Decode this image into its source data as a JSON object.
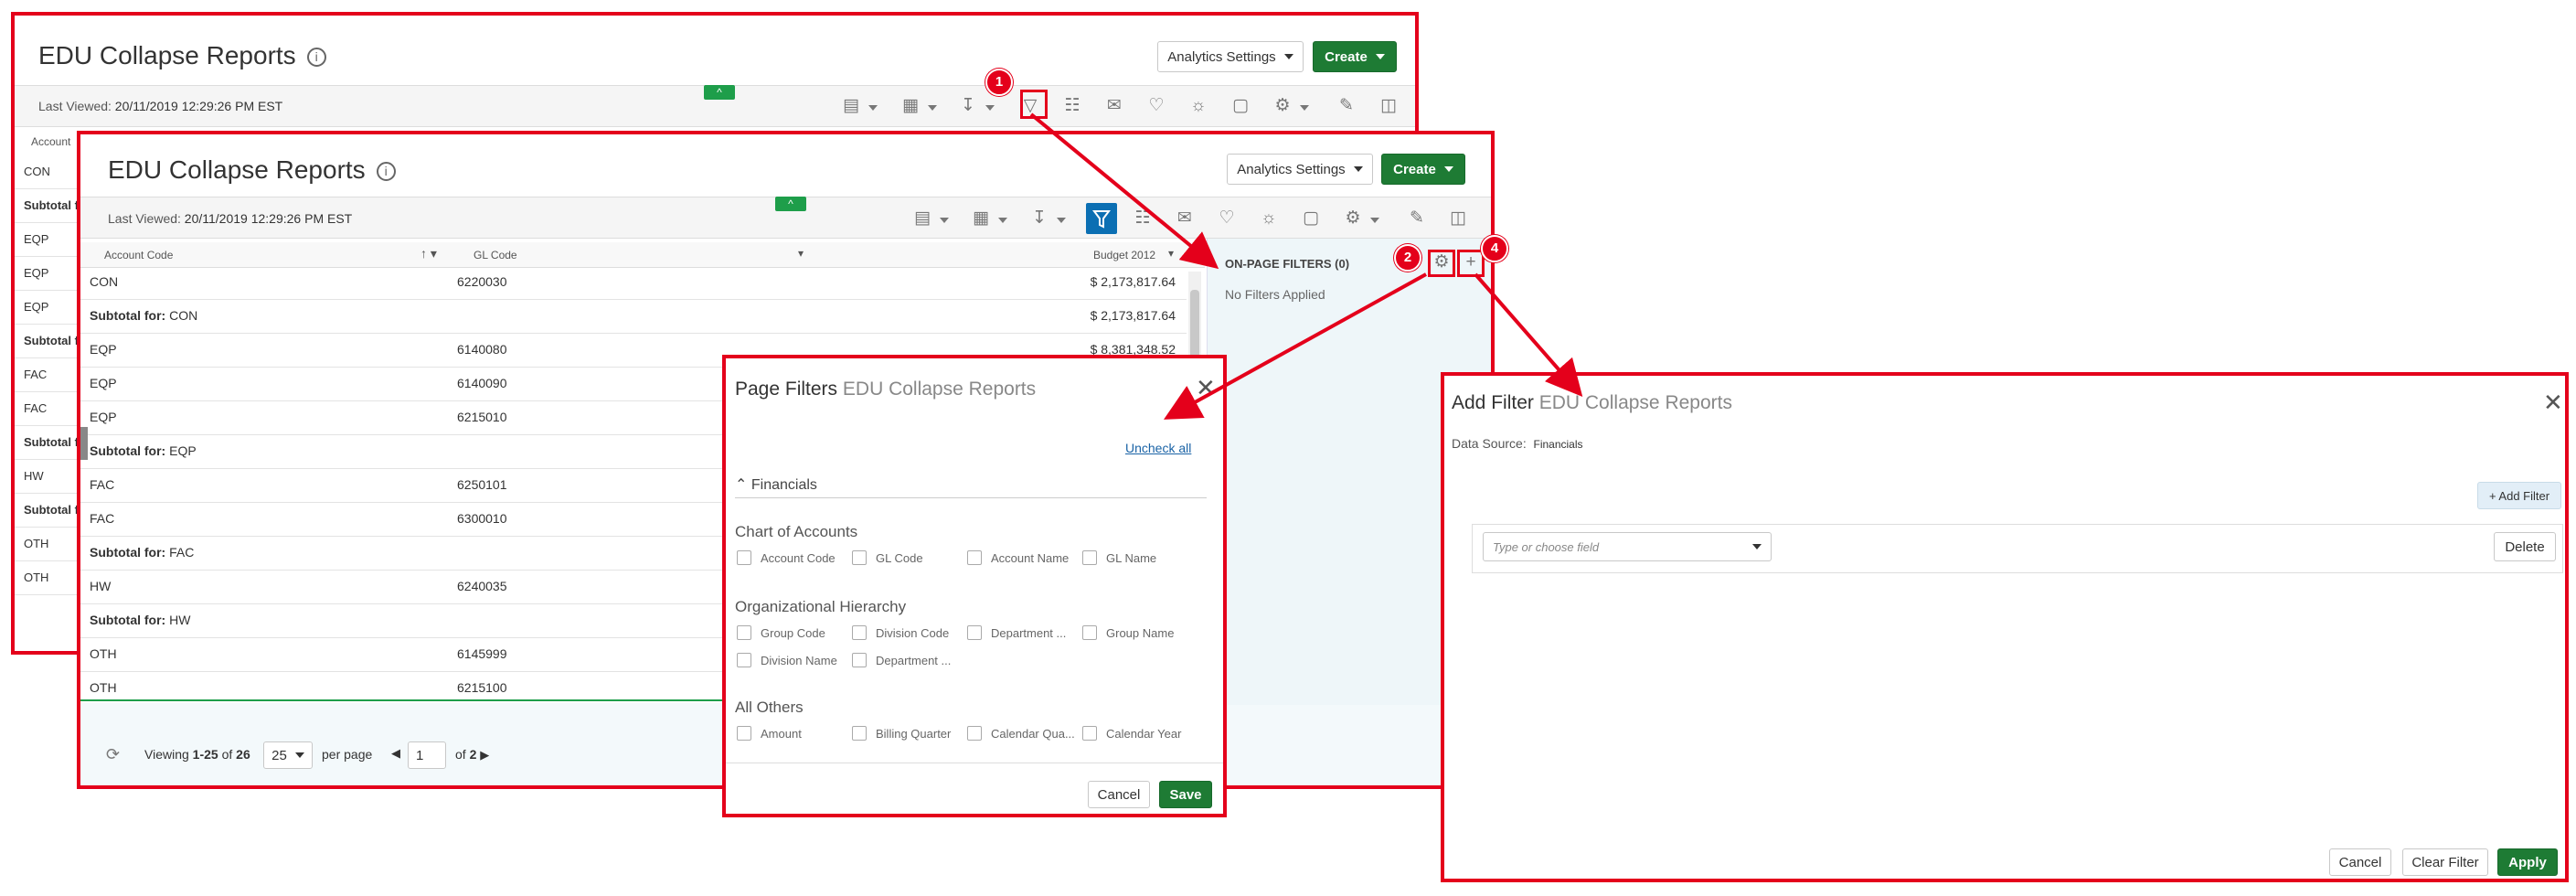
{
  "report": {
    "title": "EDU Collapse Reports",
    "analytics_label": "Analytics Settings",
    "create_label": "Create",
    "last_viewed_label": "Last Viewed:",
    "last_viewed_value": "20/11/2019 12:29:26 PM EST"
  },
  "back_rows": [
    "CON",
    "Subtotal f",
    "EQP",
    "EQP",
    "EQP",
    "Subtotal f",
    "FAC",
    "FAC",
    "Subtotal f",
    "HW",
    "Subtotal f",
    "OTH",
    "OTH"
  ],
  "back_header": "Account",
  "table": {
    "headers": {
      "account": "Account Code",
      "gl": "GL Code",
      "budget": "Budget 2012"
    },
    "rows": [
      {
        "account": "CON",
        "gl": "6220030",
        "budget": "$ 2,173,817.64"
      },
      {
        "subtotal_prefix": "Subtotal for:",
        "subtotal_of": "CON",
        "budget": "$ 2,173,817.64"
      },
      {
        "account": "EQP",
        "gl": "6140080",
        "budget": "$ 8,381,348.52"
      },
      {
        "account": "EQP",
        "gl": "6140090",
        "budget": ""
      },
      {
        "account": "EQP",
        "gl": "6215010",
        "budget": ""
      },
      {
        "subtotal_prefix": "Subtotal for:",
        "subtotal_of": "EQP",
        "budget": ""
      },
      {
        "account": "FAC",
        "gl": "6250101",
        "budget": ""
      },
      {
        "account": "FAC",
        "gl": "6300010",
        "budget": ""
      },
      {
        "subtotal_prefix": "Subtotal for:",
        "subtotal_of": "FAC",
        "budget": ""
      },
      {
        "account": "HW",
        "gl": "6240035",
        "budget": ""
      },
      {
        "subtotal_prefix": "Subtotal for:",
        "subtotal_of": "HW",
        "budget": ""
      },
      {
        "account": "OTH",
        "gl": "6145999",
        "budget": ""
      },
      {
        "account": "OTH",
        "gl": "6215100",
        "budget": ""
      }
    ]
  },
  "pagination": {
    "viewing": "Viewing",
    "range": "1-25",
    "of": "of",
    "total": "26",
    "per_page_value": "25",
    "per_page_label": "per page",
    "page_value": "1",
    "of_pages": "of",
    "pages": "2"
  },
  "onpage": {
    "title": "ON-PAGE FILTERS (0)",
    "empty": "No Filters Applied"
  },
  "page_filters": {
    "title_prefix": "Page Filters",
    "title_suffix": "EDU Collapse Reports",
    "uncheck_all": "Uncheck all",
    "section": "Financials",
    "groups": [
      {
        "label": "Chart of Accounts",
        "items": [
          "Account Code",
          "GL Code",
          "Account Name",
          "GL Name"
        ]
      },
      {
        "label": "Organizational Hierarchy",
        "items": [
          "Group Code",
          "Division Code",
          "Department ...",
          "Group Name",
          "Division Name",
          "Department ..."
        ]
      },
      {
        "label": "All Others",
        "items": [
          "Amount",
          "Billing Quarter",
          "Calendar Qua...",
          "Calendar Year"
        ]
      }
    ],
    "cancel": "Cancel",
    "save": "Save"
  },
  "add_filter": {
    "title_prefix": "Add Filter",
    "title_suffix": "EDU Collapse Reports",
    "data_source_label": "Data Source:",
    "data_source_value": "Financials",
    "add_filter_button": "+ Add Filter",
    "field_placeholder": "Type or choose field",
    "delete": "Delete",
    "cancel": "Cancel",
    "clear": "Clear Filter",
    "apply": "Apply"
  },
  "badges": [
    "1",
    "2",
    "4"
  ],
  "colors": {
    "accent_red": "#e4001b",
    "brand_green": "#1e7b34",
    "filter_blue": "#0b6fb3"
  }
}
